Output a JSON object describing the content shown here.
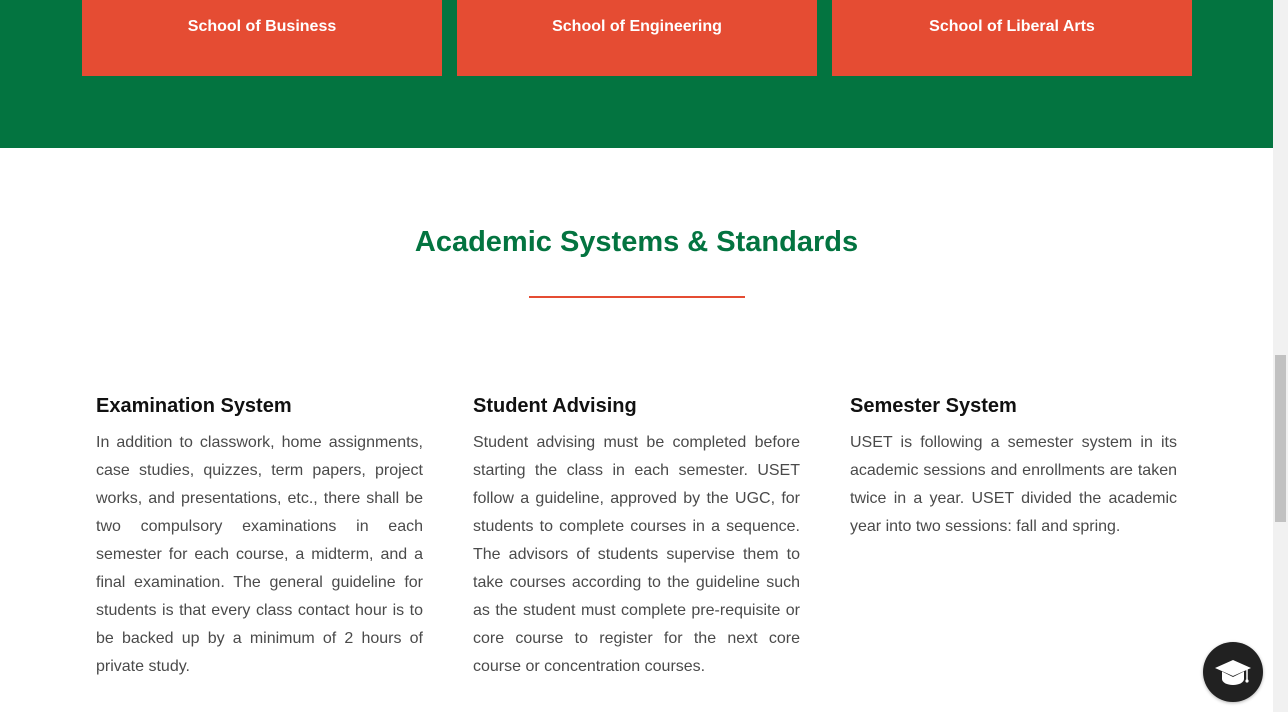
{
  "schools": [
    {
      "label": "School of Business"
    },
    {
      "label": "School of Engineering"
    },
    {
      "label": "School of Liberal Arts"
    }
  ],
  "section": {
    "title": "Academic Systems & Standards"
  },
  "columns": [
    {
      "heading": "Examination System",
      "text": "In addition to classwork, home assignments, case studies, quizzes, term papers, project works, and presentations, etc., there shall be two compulsory examinations in each semester for each course, a midterm, and a final examination. The general guideline for students is that every class contact hour is to be backed up by a minimum of 2 hours of private study."
    },
    {
      "heading": "Student Advising",
      "text": "Student advising must be completed before starting the class in each semester. USET follow a guideline, approved by the UGC, for students to complete courses in a sequence. The advisors of students supervise them to take courses according to the guideline such as the student must complete pre-requisite or core course to register for the next core course or concentration courses."
    },
    {
      "heading": "Semester System",
      "text": "USET is following a semester system in its academic sessions and enrollments are taken twice in a year. USET divided the academic year into two sessions: fall and spring."
    }
  ],
  "floating_button": {
    "icon": "graduation-cap-icon"
  },
  "colors": {
    "brand_green": "#037440",
    "accent_orange": "#e54c33"
  }
}
